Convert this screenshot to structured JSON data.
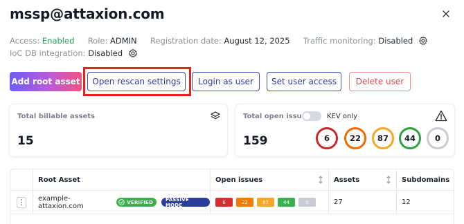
{
  "header": {
    "title": "mssp@attaxion.com"
  },
  "meta": {
    "access_label": "Access:",
    "access_value": "Enabled",
    "role_label": "Role:",
    "role_value": "ADMIN",
    "registration_label": "Registration date:",
    "registration_value": "August 12, 2025",
    "traffic_label": "Traffic monitoring:",
    "traffic_value": "Disabled",
    "ioc_label": "IoC DB integration:",
    "ioc_value": "Disabled"
  },
  "actions": {
    "add_root": "Add root asset",
    "open_rescan": "Open rescan settings",
    "login_as_user": "Login as user",
    "set_user_access": "Set user access",
    "delete_user": "Delete user"
  },
  "cards": {
    "billable": {
      "label": "Total billable assets",
      "value": "15",
      "icon": "layers-icon"
    },
    "issues": {
      "label": "Total open issues",
      "value": "159",
      "kev_label": "KEV only",
      "kev_enabled": false,
      "icon": "warning-icon",
      "severity": [
        {
          "name": "critical",
          "count": "6",
          "color": "#c62828"
        },
        {
          "name": "high",
          "count": "22",
          "color": "#ef6c00"
        },
        {
          "name": "medium",
          "count": "87",
          "color": "#f5a623"
        },
        {
          "name": "low",
          "count": "44",
          "color": "#2e9e3e"
        },
        {
          "name": "info",
          "count": "0",
          "color": "#c9ccd2"
        }
      ]
    }
  },
  "table": {
    "columns": [
      "Root Asset",
      "Open issues",
      "Assets",
      "Subdomains"
    ],
    "rows": [
      {
        "menu": "⋮",
        "root_asset": "example-attaxion.com",
        "verified_badge": "VERIFIED",
        "mode_badge": "PASSIVE MODE",
        "issues": [
          "6",
          "22",
          "87",
          "44",
          "0"
        ],
        "assets": "27",
        "subdomains": "12"
      }
    ]
  },
  "colors": {
    "accent": "#2c3a9e",
    "danger": "#e04848",
    "enabled": "#23a24a",
    "highlight": "#e3241b"
  }
}
